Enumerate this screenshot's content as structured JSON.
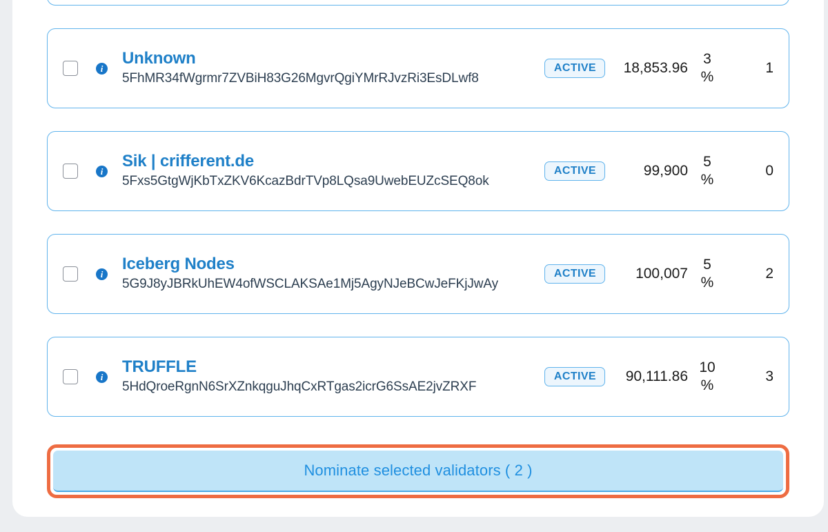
{
  "page": {
    "clipped_card_above": true,
    "accent_blue": "#1f80c8",
    "card_border_blue": "#5fb3ec",
    "focus_ring_orange": "#ee6c42",
    "button_fill_blue": "#bfe4f8"
  },
  "validators": [
    {
      "name": "Unknown",
      "address": "5FhMR34fWgrmr7ZVBiH83G26MgvrQgiYMrRJvzRi3EsDLwf8",
      "status": "ACTIVE",
      "amount": "18,853.96",
      "commission": "3 %",
      "nominators": "1",
      "checked": false,
      "info_icon": "info-icon"
    },
    {
      "name": "Sik | crifferent.de",
      "address": "5Fxs5GtgWjKbTxZKV6KcazBdrTVp8LQsa9UwebEUZcSEQ8ok",
      "status": "ACTIVE",
      "amount": "99,900",
      "commission": "5 %",
      "nominators": "0",
      "checked": false,
      "info_icon": "info-icon"
    },
    {
      "name": "Iceberg Nodes",
      "address": "5G9J8yJBRkUhEW4ofWSCLAKSAe1Mj5AgyNJeBCwJeFKjJwAy",
      "status": "ACTIVE",
      "amount": "100,007",
      "commission": "5 %",
      "nominators": "2",
      "checked": false,
      "info_icon": "info-icon"
    },
    {
      "name": "TRUFFLE",
      "address": "5HdQroeRgnN6SrXZnkqguJhqCxRTgas2icrG6SsAE2jvZRXF",
      "status": "ACTIVE",
      "amount": "90,111.86",
      "commission": "10 %",
      "nominators": "3",
      "checked": false,
      "info_icon": "info-icon"
    }
  ],
  "nominate": {
    "label": "Nominate selected validators ( 2 )",
    "selected_count": "2",
    "focused": true
  }
}
